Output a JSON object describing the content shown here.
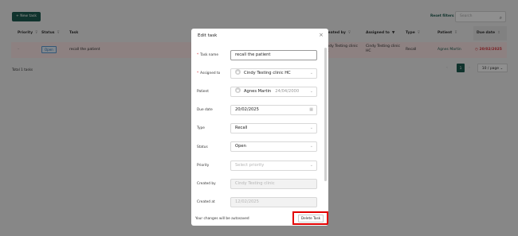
{
  "toolbar": {
    "new_task_label": "+ New task",
    "reset_filters_label": "Reset filters",
    "search_placeholder": "Search"
  },
  "table": {
    "columns": [
      "Priority",
      "Status",
      "Task",
      "Created by",
      "Assigned to",
      "Type",
      "Patient",
      "Due date"
    ],
    "rows": [
      {
        "priority": "–",
        "status": "Open",
        "task": "recall the patient",
        "created_by_line1": "Cindy Testing clinic",
        "created_by_line2": "HC",
        "assigned_to_line1": "Cindy Testing clinic",
        "assigned_to_line2": "HC",
        "type": "Recall",
        "patient": "Agnes Martin",
        "due_date": "20/02/2025"
      }
    ],
    "total_label": "Total 1 tasks"
  },
  "pagination": {
    "current_page": "1",
    "page_size_label": "10 / page"
  },
  "modal": {
    "title": "Edit task",
    "fields": {
      "task_name": {
        "label": "Task name",
        "value": "recall the patient"
      },
      "assigned_to": {
        "label": "Assigned to",
        "value": "Cindy Testing clinic HC"
      },
      "patient": {
        "label": "Patient",
        "value": "Agnes Martin",
        "dob": "24/04/2000"
      },
      "due_date": {
        "label": "Due date",
        "value": "20/02/2025"
      },
      "type": {
        "label": "Type",
        "value": "Recall"
      },
      "status": {
        "label": "Status",
        "value": "Open"
      },
      "priority": {
        "label": "Priority",
        "placeholder": "Select priority"
      },
      "created_by": {
        "label": "Created by",
        "value": "Cindy Testing clinic"
      },
      "created_at": {
        "label": "Created at",
        "value": "12/02/2025"
      }
    },
    "autosave_text": "Your changes will be autosaved",
    "delete_label": "Delete Task"
  },
  "colors": {
    "brand": "#1e5c50",
    "overdue": "#d9363e",
    "highlight": "#e30000"
  }
}
